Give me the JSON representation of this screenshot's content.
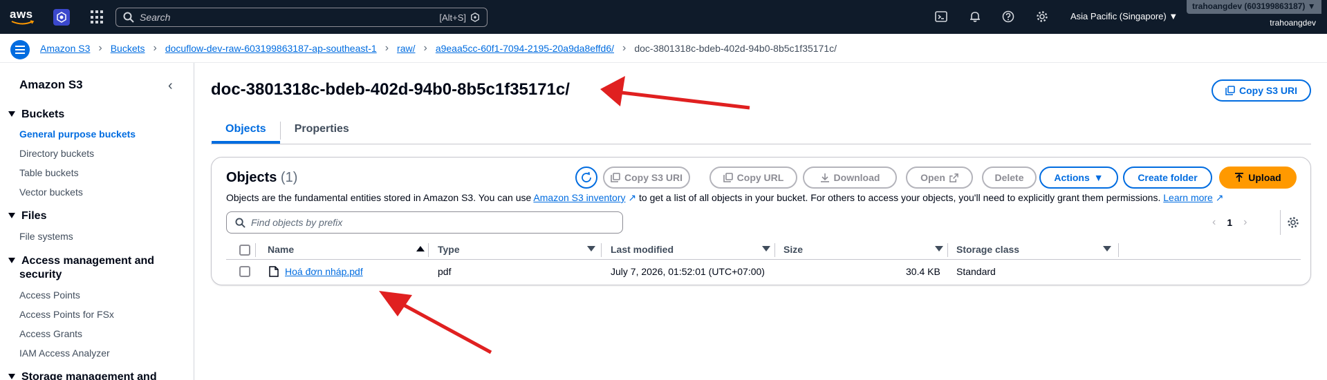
{
  "topnav": {
    "logo": "aws",
    "search_placeholder": "Search",
    "search_shortcut": "[Alt+S]",
    "region": "Asia Pacific (Singapore)",
    "account": "trahoangdev (603199863187)",
    "username": "trahoangdev",
    "icons": [
      "cloudshell-icon",
      "bell-icon",
      "help-icon",
      "settings-icon"
    ]
  },
  "breadcrumb": {
    "items": [
      "Amazon S3",
      "Buckets",
      "docuflow-dev-raw-603199863187-ap-southeast-1",
      "raw/",
      "a9eaa5cc-60f1-7094-2195-20a9da8effd6/"
    ],
    "current": "doc-3801318c-bdeb-402d-94b0-8b5c1f35171c/"
  },
  "sidebar": {
    "title": "Amazon S3",
    "sections": [
      {
        "label": "Buckets",
        "items": [
          "General purpose buckets",
          "Directory buckets",
          "Table buckets",
          "Vector buckets"
        ]
      },
      {
        "label": "Files",
        "items": [
          "File systems"
        ]
      },
      {
        "label": "Access management and",
        "label2": "security",
        "items": [
          "Access Points",
          "Access Points for FSx",
          "Access Grants",
          "IAM Access Analyzer"
        ]
      },
      {
        "label": "Storage management and"
      }
    ],
    "active_item": "General purpose buckets"
  },
  "main": {
    "title": "doc-3801318c-bdeb-402d-94b0-8b5c1f35171c/",
    "copy_uri_label": "Copy S3 URI",
    "tabs": [
      "Objects",
      "Properties"
    ],
    "active_tab": "Objects"
  },
  "objects": {
    "title": "Objects",
    "count": "(1)",
    "buttons": {
      "copy_s3_uri": "Copy S3 URI",
      "copy_url": "Copy URL",
      "download": "Download",
      "open": "Open",
      "delete": "Delete",
      "actions": "Actions",
      "create_folder": "Create folder",
      "upload": "Upload"
    },
    "description": {
      "part1": "Objects are the fundamental entities stored in Amazon S3. You can use",
      "link1": "Amazon S3 inventory",
      "part2": "to get a list of all objects in your bucket. For others to access your objects, you'll need to explicitly grant them permissions.",
      "link2": "Learn more"
    },
    "filter_placeholder": "Find objects by prefix",
    "page": "1",
    "columns": [
      "Name",
      "Type",
      "Last modified",
      "Size",
      "Storage class"
    ],
    "rows": [
      {
        "name": "Hoá đơn nháp.pdf",
        "type": "pdf",
        "last_modified": "July 7, 2026, 01:52:01 (UTC+07:00)",
        "size": "30.4 KB",
        "storage_class": "Standard"
      }
    ]
  },
  "colors": {
    "topnav_bg": "#0f1b2a",
    "link": "#006ce0",
    "upload": "#ff9900",
    "annotation_arrow": "#e02020"
  }
}
